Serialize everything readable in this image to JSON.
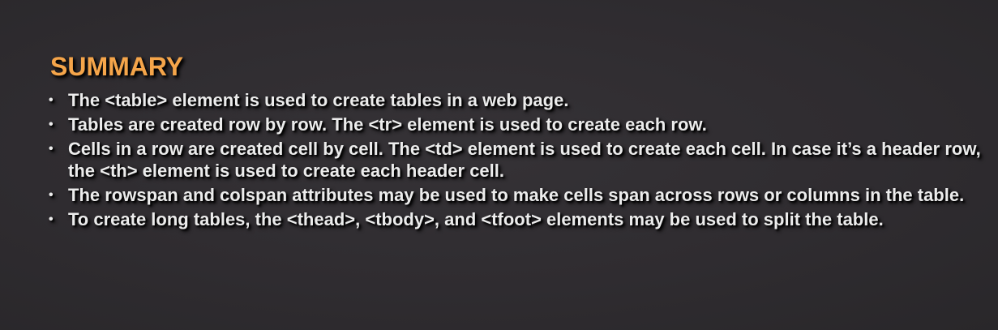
{
  "title": "SUMMARY",
  "bullet_glyph": "•",
  "bullets": [
    "The <table> element is used to create tables in a web page.",
    "Tables are created row by row. The <tr> element is used to create each row.",
    "Cells in a row are created cell by cell. The <td> element is used to create each cell. In case it’s a header row, the <th> element is used to create each header cell.",
    "The rowspan and colspan attributes may be used to make cells span across rows or columns in the table.",
    "To create long tables, the <thead>, <tbody>, and <tfoot> elements may be used to split the table."
  ],
  "colors": {
    "title": "#f5a54a",
    "text": "#ececec",
    "background": "#2f2c30"
  }
}
